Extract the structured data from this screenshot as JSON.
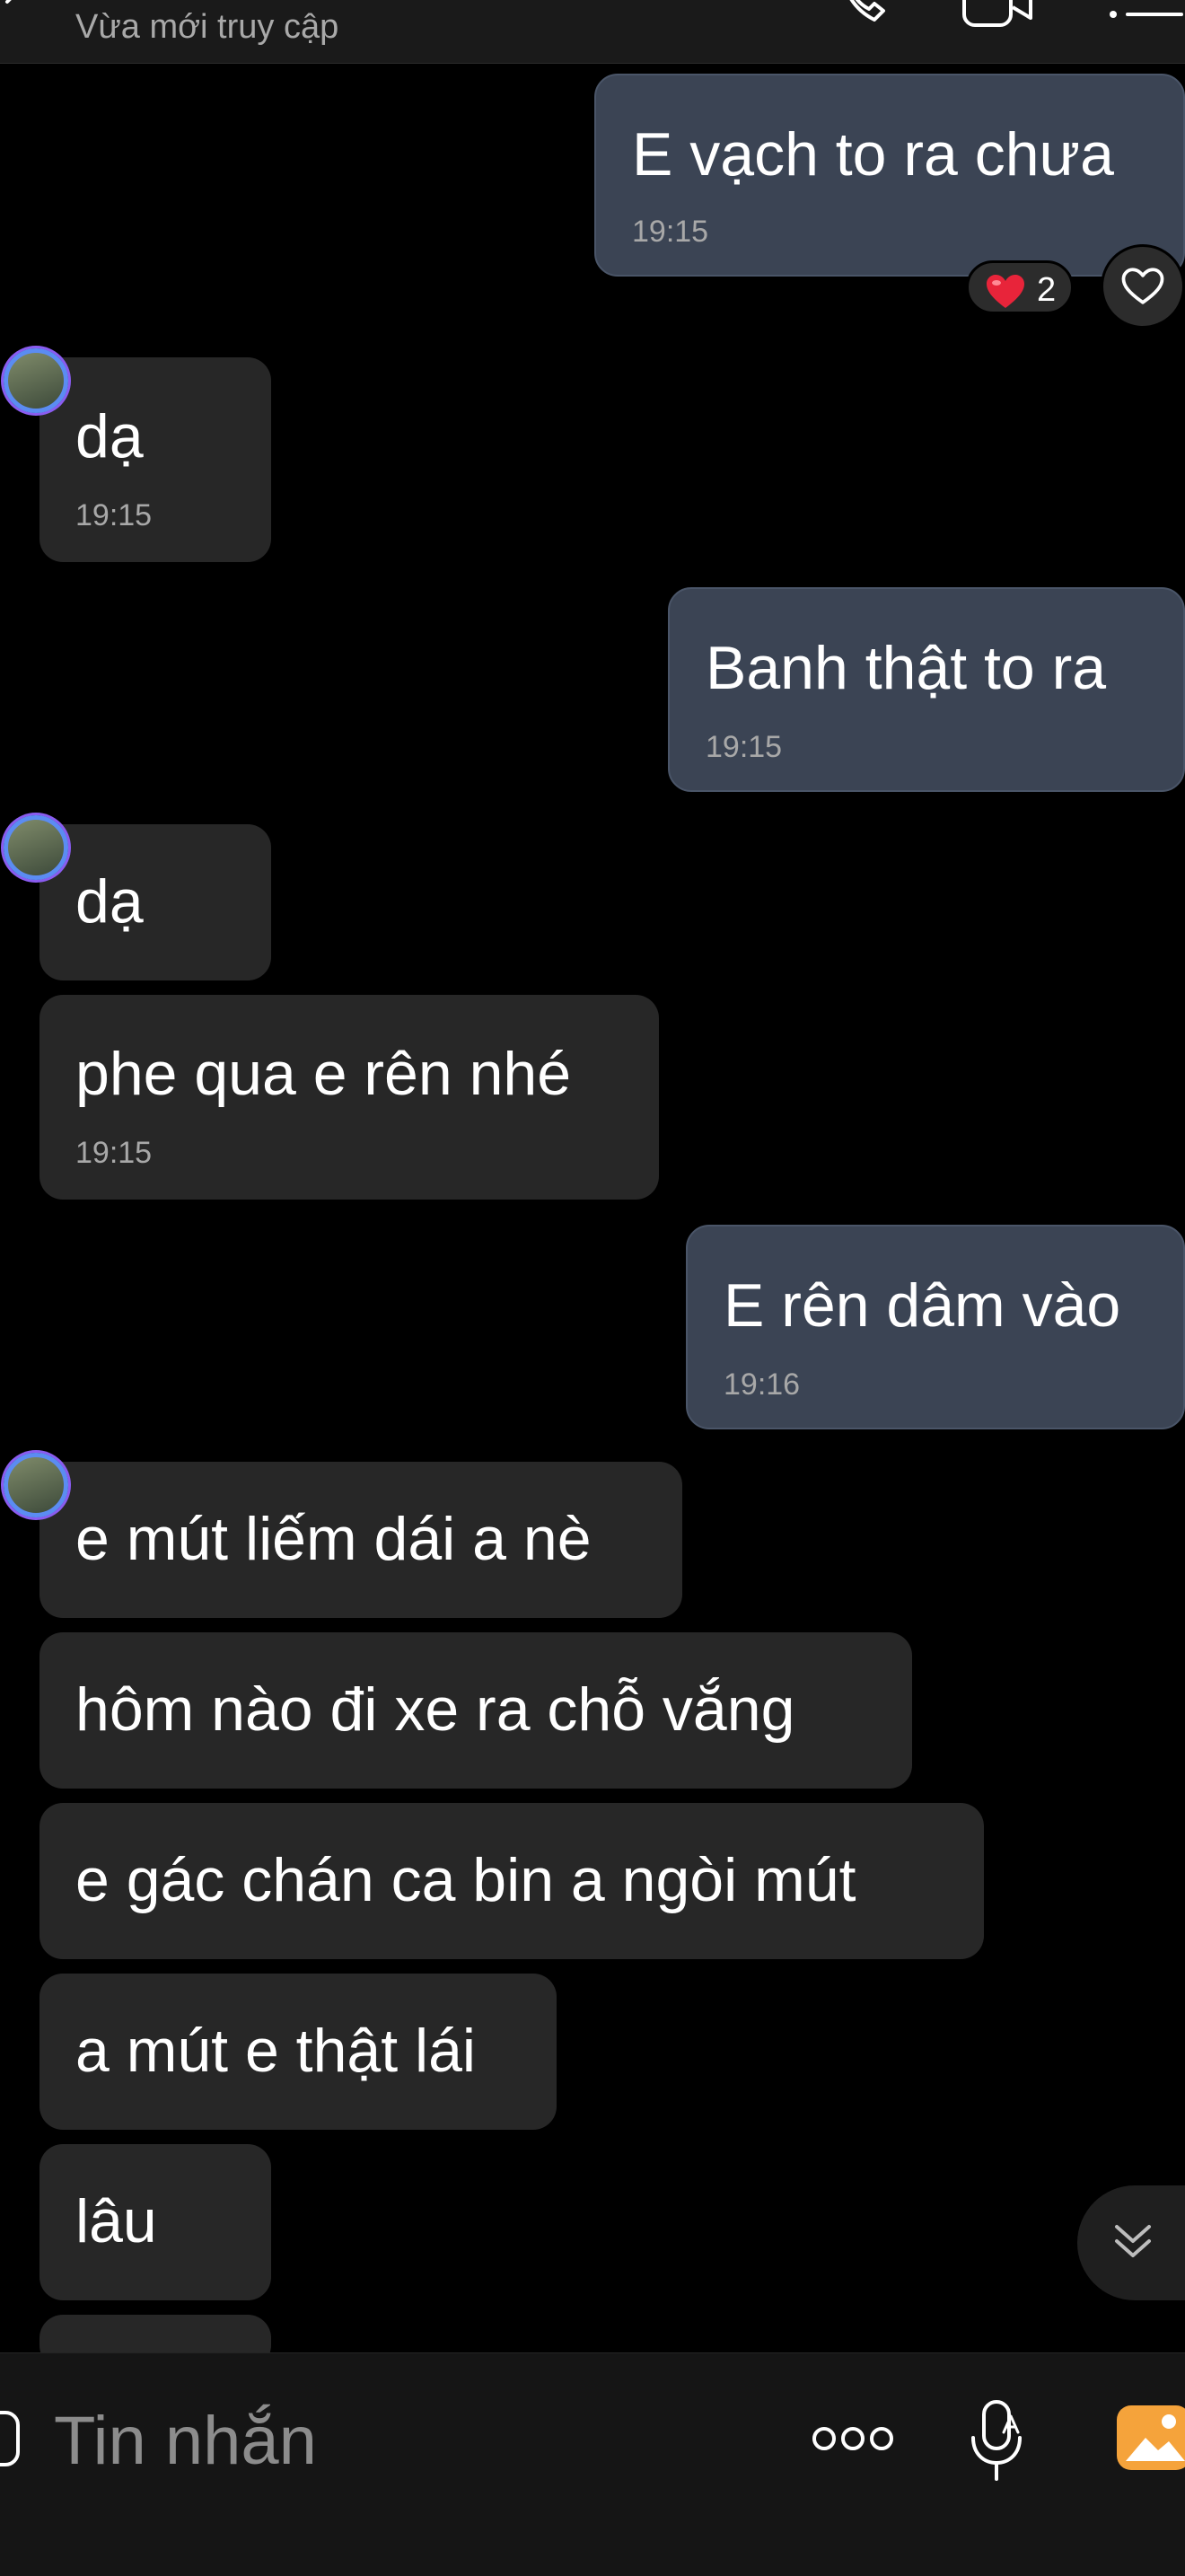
{
  "header": {
    "status": "Vừa mới truy cập"
  },
  "messages": [
    {
      "id": "m1",
      "direction": "outgoing",
      "text": "E vạch to ra chưa",
      "time": "19:15",
      "reaction": {
        "icon": "heart-filled-icon",
        "count": "2"
      }
    },
    {
      "id": "m2",
      "direction": "incoming",
      "text": "dạ",
      "time": "19:15",
      "avatar": true
    },
    {
      "id": "m3",
      "direction": "outgoing",
      "text": "Banh thật to ra",
      "time": "19:15"
    },
    {
      "id": "m4",
      "direction": "incoming",
      "text": "dạ",
      "avatar": true
    },
    {
      "id": "m5",
      "direction": "incoming",
      "text": "phe qua e rên nhé",
      "time": "19:15"
    },
    {
      "id": "m6",
      "direction": "outgoing",
      "text": "E rên dâm vào",
      "time": "19:16"
    },
    {
      "id": "m7",
      "direction": "incoming",
      "text": "e mút liếm dái a nè",
      "avatar": true
    },
    {
      "id": "m8",
      "direction": "incoming",
      "text": "hôm nào đi xe ra chỗ vắng"
    },
    {
      "id": "m9",
      "direction": "incoming",
      "text": "e gác chán ca bin a ngòi mút"
    },
    {
      "id": "m10",
      "direction": "incoming",
      "text": "a mút e thật lái"
    },
    {
      "id": "m11",
      "direction": "incoming",
      "text": "lâu"
    }
  ],
  "composer": {
    "placeholder": "Tin nhắn",
    "icons": [
      "sticker-icon",
      "more-icon",
      "voice-icon",
      "photo-icon"
    ]
  },
  "colors": {
    "background": "#000000",
    "incoming_bubble": "#272727",
    "outgoing_bubble": "#3b4454",
    "timestamp": "#a8a8a8",
    "photo_icon": "#f5a33b",
    "heart": "#e8243a"
  }
}
